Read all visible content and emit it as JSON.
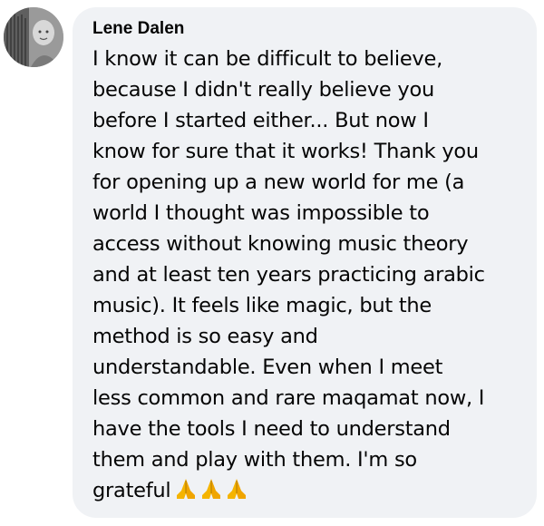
{
  "comment": {
    "author": "Lene Dalen",
    "lines": [
      "I know it can be difficult to believe,",
      "because I didn't really believe you",
      "before I started either... But now I",
      "know for sure that it works! Thank you",
      "for opening up a new world for me (a",
      "world I thought was impossible to",
      "access without knowing music theory",
      "and at least ten years practicing arabic",
      "music). It feels like magic, but the",
      "method is so easy and",
      "understandable. Even when I meet",
      "less common and rare maqamat now, I",
      "have the tools I need to understand",
      "them and play with them. I'm so",
      "grateful"
    ],
    "emoji": [
      "folded-hands-emoji",
      "folded-hands-emoji",
      "folded-hands-emoji"
    ]
  },
  "colors": {
    "bubble": "#f0f2f5",
    "text": "#050505",
    "emoji": "#f5b400"
  }
}
